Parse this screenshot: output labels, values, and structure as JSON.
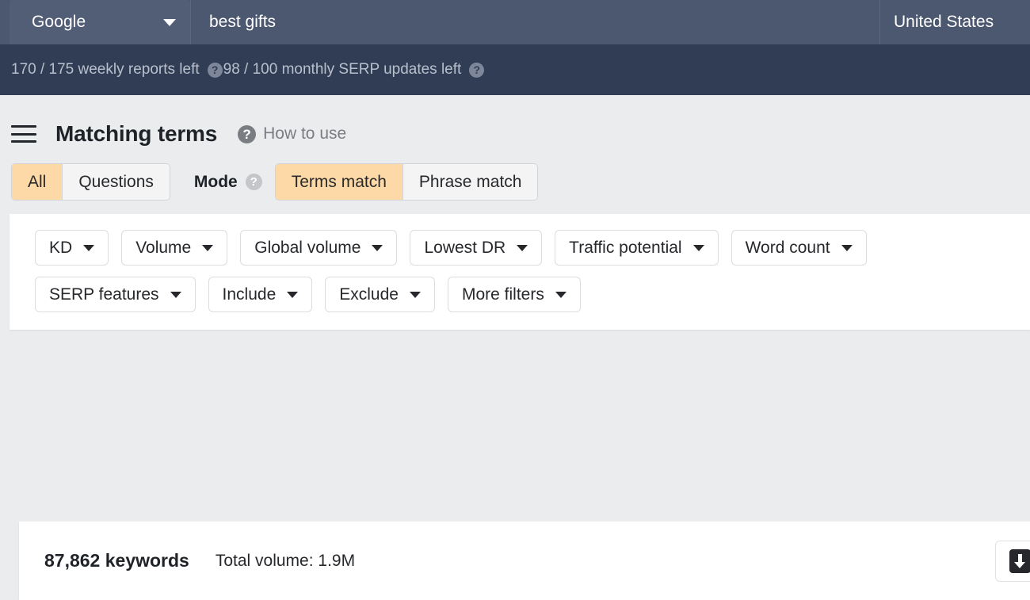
{
  "topnav": {
    "engine": {
      "label": "Google",
      "icon": "chevron-down-icon"
    },
    "query": "best gifts",
    "country": "United States",
    "quota": {
      "weekly_reports": "170 / 175 weekly reports left",
      "monthly_serp": "98 / 100 monthly SERP updates left",
      "help_glyph": "?"
    }
  },
  "page": {
    "menu_icon": "hamburger-icon",
    "title": "Matching terms",
    "how_to_use": {
      "icon_glyph": "?",
      "label": "How to use"
    }
  },
  "toggles": {
    "type_tabs": [
      {
        "label": "All",
        "active": true
      },
      {
        "label": "Questions",
        "active": false
      }
    ],
    "mode_label": "Mode",
    "mode_help_glyph": "?",
    "mode_tabs": [
      {
        "label": "Terms match",
        "active": true
      },
      {
        "label": "Phrase match",
        "active": false
      }
    ]
  },
  "filters": {
    "row1": [
      {
        "label": "KD"
      },
      {
        "label": "Volume"
      },
      {
        "label": "Global volume"
      },
      {
        "label": "Lowest DR"
      },
      {
        "label": "Traffic potential"
      },
      {
        "label": "Word count"
      }
    ],
    "row2": [
      {
        "label": "SERP features"
      },
      {
        "label": "Include"
      },
      {
        "label": "Exclude"
      },
      {
        "label": "More filters"
      }
    ]
  },
  "results": {
    "keyword_count": "87,862 keywords",
    "total_volume": "Total volume: 1.9M",
    "export_icon": "export-download-icon"
  },
  "colors": {
    "nav_dark": "#313d55",
    "nav_searchbar": "#4c5770",
    "accent_orange": "#fcd9a6",
    "page_bg": "#ebecee",
    "card_bg": "#ffffff"
  }
}
